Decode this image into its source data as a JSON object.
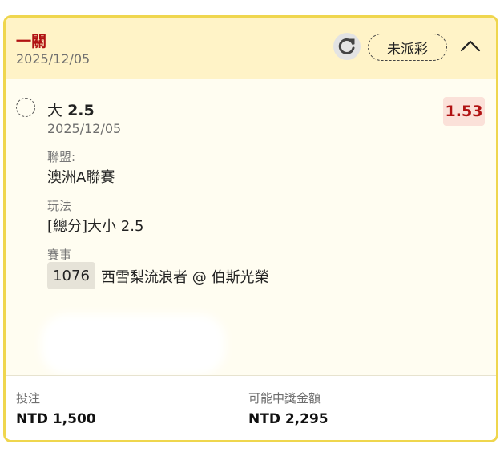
{
  "header": {
    "title": "一關",
    "date": "2025/12/05",
    "status_label": "未派彩",
    "refresh_icon": "refresh-icon",
    "collapse_icon": "chevron-up-icon"
  },
  "selection": {
    "pick": "大",
    "line": "2.5",
    "odds": "1.53",
    "date": "2025/12/05"
  },
  "details": {
    "league_label": "聯盟:",
    "league_value": "澳洲A聯賽",
    "market_label": "玩法",
    "market_value": "[總分]大小 2.5",
    "event_label": "賽事",
    "event_id": "1076",
    "event_name": "西雪梨流浪者 @ 伯斯光榮"
  },
  "footer": {
    "stake_label": "投注",
    "stake_value": "NTD 1,500",
    "payout_label": "可能中獎金額",
    "payout_value": "NTD 2,295"
  },
  "colors": {
    "accent_border": "#efd64e",
    "header_bg": "#fff3c7",
    "body_bg": "#fffdf1",
    "title_red": "#b01212",
    "odds_bg": "#fbe1d9"
  }
}
